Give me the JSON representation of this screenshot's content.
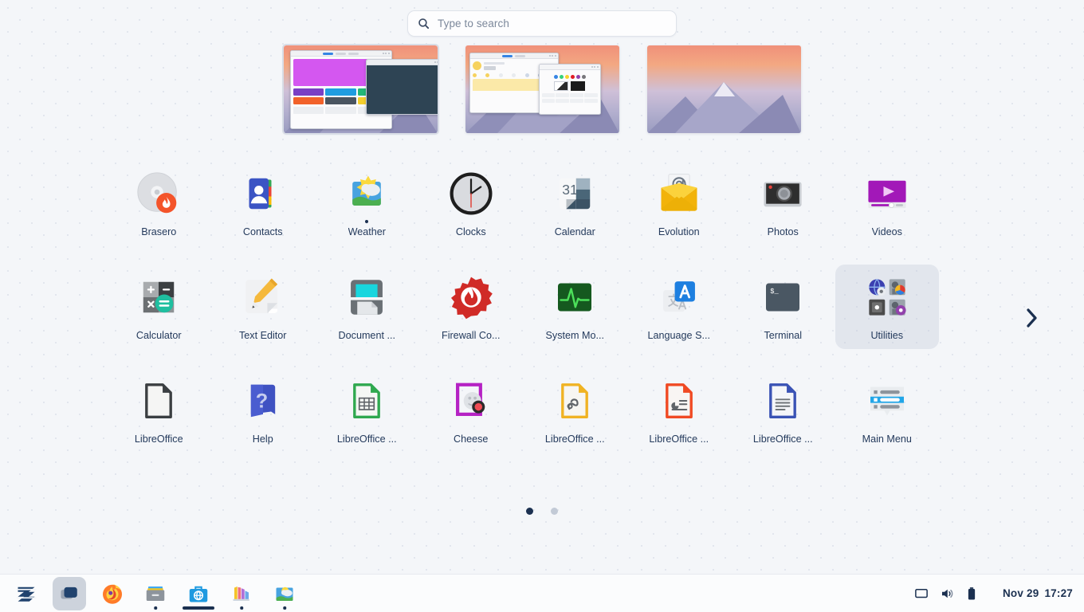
{
  "search": {
    "placeholder": "Type to search",
    "icon": "search-icon"
  },
  "workspaces": [
    {
      "name": "workspace-1",
      "selected": true,
      "content": "software-center-window"
    },
    {
      "name": "workspace-2",
      "selected": false,
      "content": "weather-and-color-picker-windows"
    },
    {
      "name": "workspace-3",
      "selected": false,
      "content": "empty-desktop-wallpaper"
    }
  ],
  "app_grid": {
    "rows": [
      [
        {
          "label": "Brasero",
          "icon": "brasero-icon",
          "running": false,
          "folder": false
        },
        {
          "label": "Contacts",
          "icon": "contacts-icon",
          "running": false,
          "folder": false
        },
        {
          "label": "Weather",
          "icon": "weather-icon",
          "running": true,
          "folder": false
        },
        {
          "label": "Clocks",
          "icon": "clocks-icon",
          "running": false,
          "folder": false
        },
        {
          "label": "Calendar",
          "icon": "calendar-icon",
          "running": false,
          "folder": false
        },
        {
          "label": "Evolution",
          "icon": "evolution-icon",
          "running": false,
          "folder": false
        },
        {
          "label": "Photos",
          "icon": "photos-icon",
          "running": false,
          "folder": false
        },
        {
          "label": "Videos",
          "icon": "videos-icon",
          "running": false,
          "folder": false
        }
      ],
      [
        {
          "label": "Calculator",
          "icon": "calculator-icon",
          "running": false,
          "folder": false
        },
        {
          "label": "Text Editor",
          "icon": "text-editor-icon",
          "running": false,
          "folder": false
        },
        {
          "label": "Document ...",
          "icon": "document-scanner-icon",
          "running": false,
          "folder": false
        },
        {
          "label": "Firewall Co...",
          "icon": "firewall-icon",
          "running": false,
          "folder": false
        },
        {
          "label": "System Mo...",
          "icon": "system-monitor-icon",
          "running": false,
          "folder": false
        },
        {
          "label": "Language S...",
          "icon": "language-selector-icon",
          "running": false,
          "folder": false
        },
        {
          "label": "Terminal",
          "icon": "terminal-icon",
          "running": false,
          "folder": false
        },
        {
          "label": "Utilities",
          "icon": "utilities-folder-icon",
          "running": false,
          "folder": true
        }
      ],
      [
        {
          "label": "LibreOffice",
          "icon": "libreoffice-start-icon",
          "running": false,
          "folder": false
        },
        {
          "label": "Help",
          "icon": "help-icon",
          "running": false,
          "folder": false
        },
        {
          "label": "LibreOffice ...",
          "icon": "libreoffice-calc-icon",
          "running": false,
          "folder": false
        },
        {
          "label": "Cheese",
          "icon": "cheese-icon",
          "running": false,
          "folder": false
        },
        {
          "label": "LibreOffice ...",
          "icon": "libreoffice-draw-icon",
          "running": false,
          "folder": false
        },
        {
          "label": "LibreOffice ...",
          "icon": "libreoffice-impress-icon",
          "running": false,
          "folder": false
        },
        {
          "label": "LibreOffice ...",
          "icon": "libreoffice-writer-icon",
          "running": false,
          "folder": false
        },
        {
          "label": "Main Menu",
          "icon": "main-menu-icon",
          "running": false,
          "folder": false
        }
      ]
    ],
    "next_page_icon": "chevron-right-icon",
    "pages": [
      {
        "label": "1",
        "active": true
      },
      {
        "label": "2",
        "active": false
      }
    ]
  },
  "taskbar": {
    "items": [
      {
        "name": "zorin-menu",
        "icon": "zorin-logo-icon",
        "state": "none",
        "highlighted": false
      },
      {
        "name": "activities",
        "icon": "overview-icon",
        "state": "none",
        "highlighted": true
      },
      {
        "name": "firefox",
        "icon": "firefox-icon",
        "state": "dot",
        "highlighted": false
      },
      {
        "name": "files",
        "icon": "files-icon",
        "state": "dot",
        "highlighted": false
      },
      {
        "name": "software",
        "icon": "software-icon",
        "state": "focused",
        "highlighted": false
      },
      {
        "name": "color-palette",
        "icon": "palette-icon",
        "state": "dot",
        "highlighted": false
      },
      {
        "name": "weather",
        "icon": "weather-icon",
        "state": "dot",
        "highlighted": false
      }
    ],
    "tray": [
      {
        "name": "display-icon"
      },
      {
        "name": "volume-icon"
      },
      {
        "name": "battery-icon"
      }
    ],
    "clock": {
      "date": "Nov 29",
      "time": "17:27"
    }
  },
  "colors": {
    "background": "#f4f6f9",
    "text": "#1b3050",
    "accent": "#3584e4",
    "panel": "#fbfcfd",
    "highlight": "#cdd3dc"
  }
}
